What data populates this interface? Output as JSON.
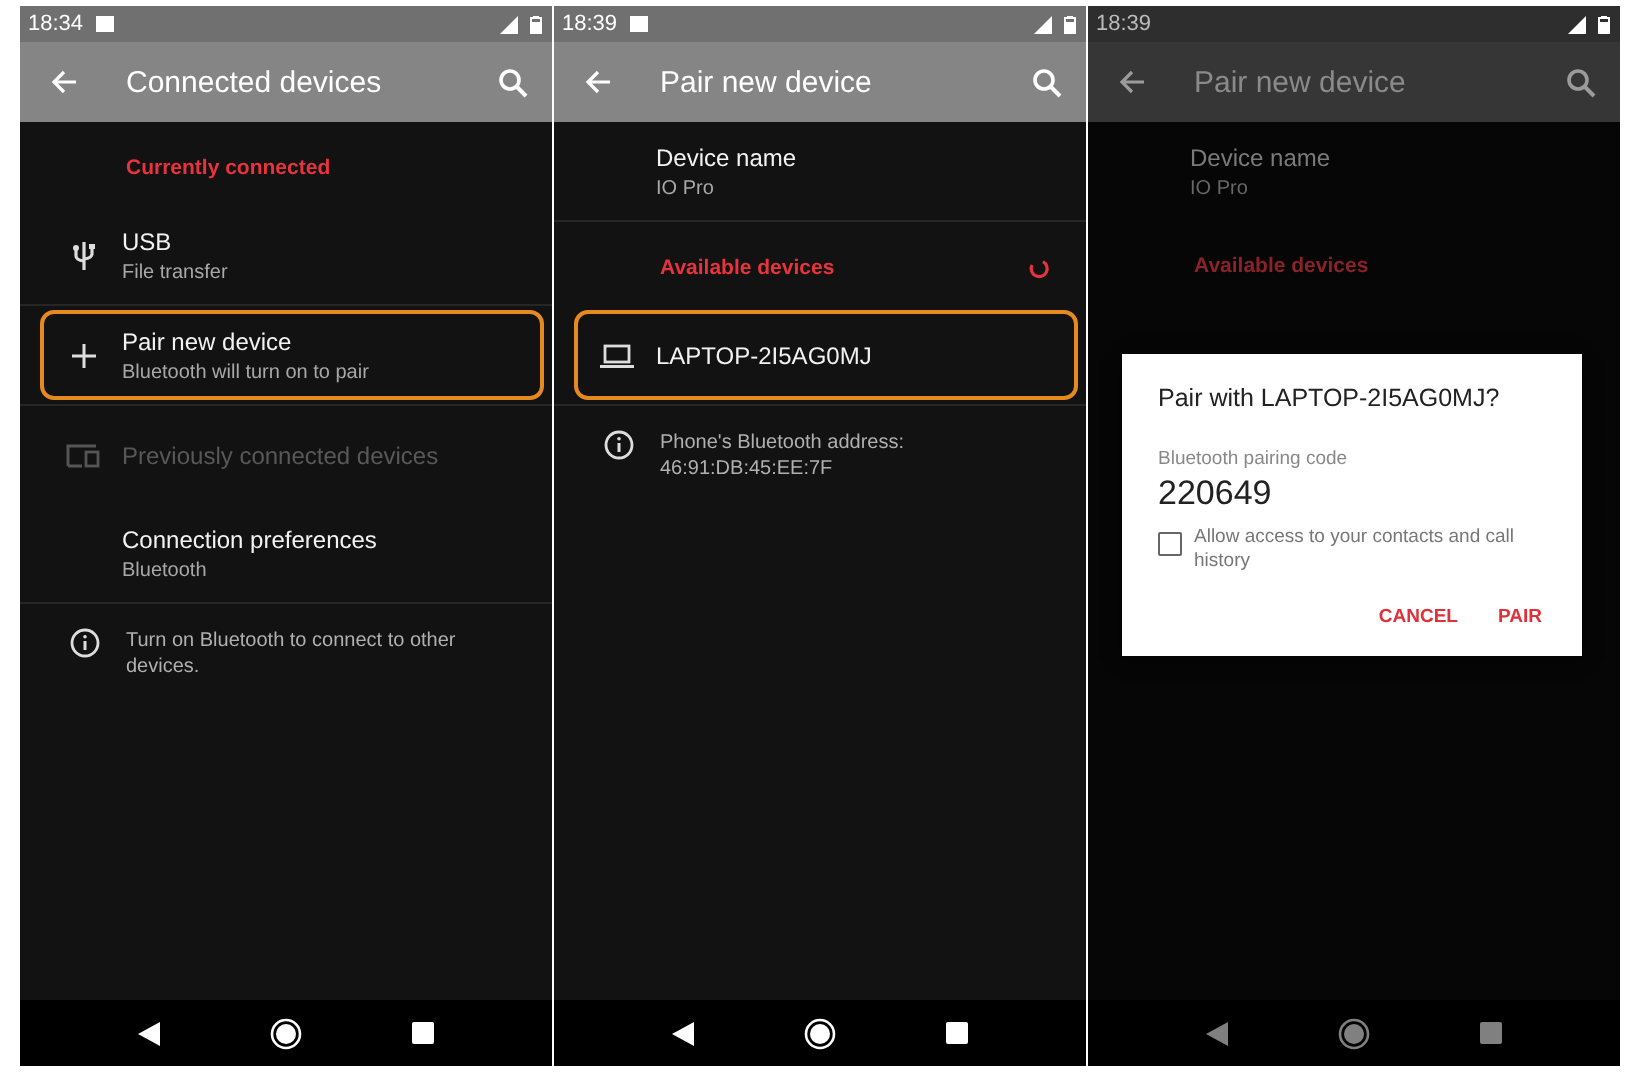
{
  "screens": [
    {
      "status": {
        "time": "18:34",
        "image_notification": true
      },
      "app_bar": {
        "title": "Connected devices"
      },
      "dimmed": false,
      "rows": [
        {
          "kind": "header",
          "text": "Currently connected",
          "spinner": false
        },
        {
          "kind": "item",
          "title": "USB",
          "subtitle": "File transfer",
          "highlighted": false,
          "disabled": false,
          "divider": true
        },
        {
          "kind": "item",
          "title": "Pair new device",
          "subtitle": "Bluetooth will turn on to pair",
          "highlighted": true,
          "disabled": false,
          "divider": true
        },
        {
          "kind": "item",
          "title": "Previously connected devices",
          "highlighted": false,
          "disabled": true,
          "divider": false
        },
        {
          "kind": "item",
          "title": "Connection preferences",
          "subtitle": "Bluetooth",
          "highlighted": false,
          "disabled": false,
          "divider": true
        },
        {
          "kind": "info",
          "text": "Turn on Bluetooth to connect to other devices."
        }
      ]
    },
    {
      "status": {
        "time": "18:39",
        "image_notification": true
      },
      "app_bar": {
        "title": "Pair new device"
      },
      "dimmed": false,
      "rows": [
        {
          "kind": "item",
          "title": "Device name",
          "subtitle": "IO Pro",
          "highlighted": false,
          "disabled": false,
          "divider": true
        },
        {
          "kind": "header",
          "text": "Available devices",
          "spinner": true
        },
        {
          "kind": "item",
          "title": "LAPTOP-2I5AG0MJ",
          "highlighted": true,
          "disabled": false,
          "divider": true
        },
        {
          "kind": "info",
          "text": "Phone's Bluetooth address: 46:91:DB:45:EE:7F"
        }
      ]
    },
    {
      "status": {
        "time": "18:39",
        "image_notification": false
      },
      "app_bar": {
        "title": "Pair new device"
      },
      "dimmed": true,
      "rows": [
        {
          "kind": "item",
          "title": "Device name",
          "subtitle": "IO Pro",
          "highlighted": false,
          "disabled": false,
          "divider": false
        },
        {
          "kind": "header",
          "text": "Available devices",
          "spinner": false
        }
      ],
      "dialog": {
        "title": "Pair with LAPTOP-2I5AG0MJ?",
        "code_label": "Bluetooth pairing code",
        "code": "220649",
        "checkbox": {
          "label": "Allow access to your contacts and call history",
          "checked": false
        },
        "buttons": [
          "CANCEL",
          "PAIR"
        ]
      }
    }
  ]
}
